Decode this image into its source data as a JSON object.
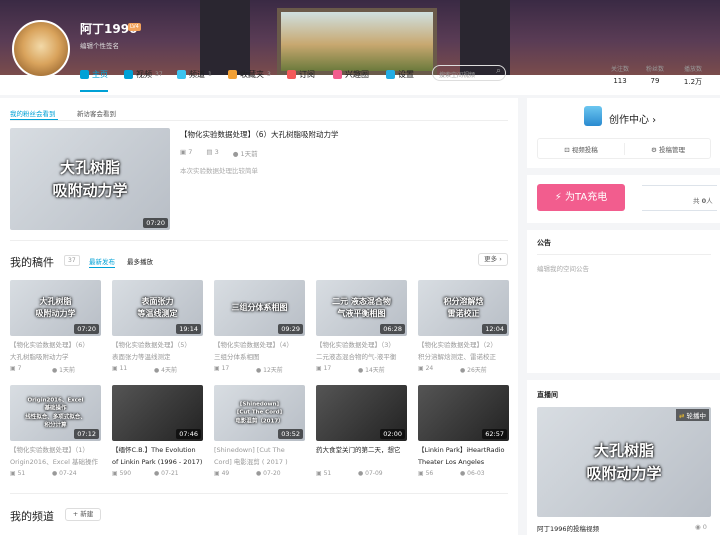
{
  "user": {
    "name": "阿丁1996",
    "level": "LV4",
    "sign": "编辑个性签名"
  },
  "nav": {
    "items": [
      {
        "label": "主页",
        "count": "",
        "color": "#00a1d6"
      },
      {
        "label": "视频",
        "count": "37",
        "color": "#00a1d6"
      },
      {
        "label": "频道",
        "count": "1",
        "color": "#3cc4f0"
      },
      {
        "label": "收藏夹",
        "count": "3",
        "color": "#f3a034"
      },
      {
        "label": "订阅",
        "count": "",
        "color": "#f45a5a"
      },
      {
        "label": "兴趣圈",
        "count": "",
        "color": "#f25d8e"
      },
      {
        "label": "设置",
        "count": "",
        "color": "#23ade5"
      }
    ],
    "search_placeholder": "搜索空间视频",
    "stats": [
      {
        "label": "关注数",
        "value": "113"
      },
      {
        "label": "粉丝数",
        "value": "79"
      },
      {
        "label": "播放数",
        "value": "1.2万"
      }
    ]
  },
  "feature": {
    "tabs": [
      "我的粉丝会看到",
      "新访客会看到"
    ],
    "title": "【物化实验数据处理】（6）大孔树脂吸附动力学",
    "plays": "7",
    "danmaku": "3",
    "time": "1天前",
    "desc": "本次实验数据处理比较简单",
    "overlay": [
      "大孔树脂",
      "吸附动力学"
    ],
    "duration": "07:20"
  },
  "uploads": {
    "title": "我的稿件",
    "count": "37",
    "tabs": [
      "最新发布",
      "最多播放"
    ],
    "more": "更多",
    "videos": [
      {
        "t1": "【物化实验数据处理】（6）",
        "t2": "大孔树脂吸附动力学",
        "plays": "7",
        "time": "1天前",
        "dur": "07:20",
        "ov": [
          "大孔树脂",
          "吸附动力学"
        ],
        "dark": false
      },
      {
        "t1": "【物化实验数据处理】（5）",
        "t2": "表面张力等温线测定",
        "plays": "11",
        "time": "4天前",
        "dur": "19:14",
        "ov": [
          "表面张力",
          "等温线测定"
        ],
        "dark": false
      },
      {
        "t1": "【物化实验数据处理】（4）",
        "t2": "三组分体系相图",
        "plays": "17",
        "time": "12天前",
        "dur": "09:29",
        "ov": [
          "三组分体系相图"
        ],
        "dark": false
      },
      {
        "t1": "【物化实验数据处理】（3）",
        "t2": "二元液态混合物的气-液平衡",
        "plays": "17",
        "time": "14天前",
        "dur": "06:28",
        "ov": [
          "二元 液态混合物",
          "气液平衡相图"
        ],
        "dark": false
      },
      {
        "t1": "【物化实验数据处理】（2）",
        "t2": "积分溶解焓测定、雷诺校正",
        "plays": "24",
        "time": "26天前",
        "dur": "12:04",
        "ov": [
          "积分溶解焓",
          "雷诺校正"
        ],
        "dark": false
      },
      {
        "t1": "【物化实验数据处理】（1）",
        "t2": "Origin2016、Excel 基础操作",
        "plays": "51",
        "time": "07-24",
        "dur": "07:12",
        "ov": [
          "Origin2016、Excel",
          "基础操作",
          "线性拟合、多项式拟合、",
          "积分计算"
        ],
        "dark": false
      },
      {
        "t1": "【缅怀C.B.】The Evolution",
        "t2": "of Linkin Park (1996 - 2017)",
        "plays": "590",
        "time": "07-21",
        "dur": "07:46",
        "ov": [],
        "dark": true
      },
      {
        "t1": "[Shinedown] [Cut The",
        "t2": "Cord] 电影混剪 ( 2017 )",
        "plays": "49",
        "time": "07-20",
        "dur": "03:52",
        "ov": [
          "[Shinedown]",
          "[Cut The Cord]",
          "电影混剪（2017）"
        ],
        "dark": false
      },
      {
        "t1": "药大食堂关门的第二天，想它",
        "t2": "",
        "plays": "51",
        "time": "07-09",
        "dur": "02:00",
        "ov": [],
        "dark": true
      },
      {
        "t1": "【Linkin Park】iHeartRadio",
        "t2": "Theater Los Angeles",
        "plays": "56",
        "time": "06-03",
        "dur": "62:57",
        "ov": [],
        "dark": true
      }
    ]
  },
  "channels": {
    "title": "我的频道",
    "new": "新建"
  },
  "side": {
    "creator": "创作中心",
    "upload": "视频投稿",
    "manage": "投稿管理",
    "charge": "为TA充电",
    "charge_count_pre": "共",
    "charge_count": "0",
    "charge_count_post": "人",
    "notice_title": "公告",
    "notice_placeholder": "编辑我的空间公告",
    "live_title": "直播间",
    "live_badge": "轮播中",
    "live_overlay": [
      "大孔树脂",
      "吸附动力学"
    ],
    "live_caption": "阿丁1996的投稿视频",
    "live_viewers": "0"
  }
}
